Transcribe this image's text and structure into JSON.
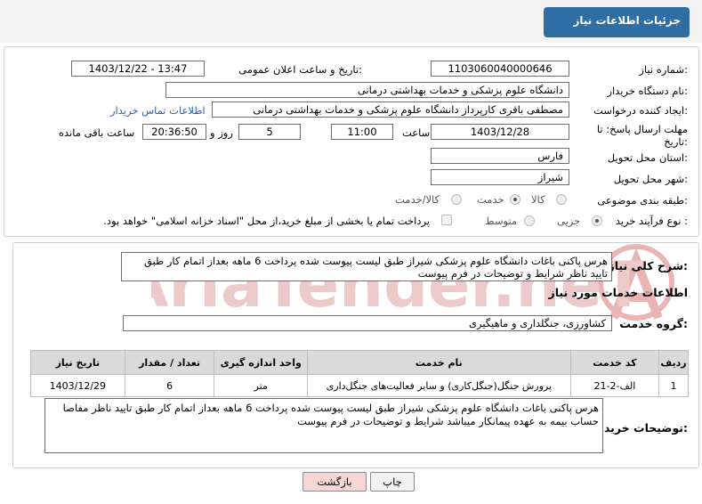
{
  "page_title": "جزئیات اطلاعات نیاز",
  "fields": {
    "need_number_label": "شماره نیاز:",
    "need_number": "1103060040000646",
    "announce_label": "تاریخ و ساعت اعلان عمومی:",
    "announce_value": "1403/12/22 - 13:47",
    "buyer_org_label": "نام دستگاه خریدار:",
    "buyer_org": "دانشگاه علوم پزشکی و خدمات بهداشتی درمانی",
    "creator_label": "ایجاد کننده درخواست:",
    "creator": "مصطفی باقری کارپرداز دانشگاه علوم پزشکی و خدمات بهداشتی درمانی",
    "contact_link": "اطلاعات تماس خریدار",
    "deadline_label": "مهلت ارسال پاسخ: تا تاریخ:",
    "deadline_date": "1403/12/28",
    "time_label": "ساعت",
    "deadline_time": "11:00",
    "days": "5",
    "days_label": "روز و",
    "remaining": "20:36:50",
    "remaining_label": "ساعت باقی مانده",
    "province_label": "استان محل تحویل:",
    "province": "فارس",
    "city_label": "شهر محل تحویل:",
    "city": "شیراز",
    "category_label": "طبقه بندی موضوعی:",
    "category_options": [
      "کالا",
      "خدمت",
      "کالا/خدمت"
    ],
    "process_label": "نوع فرآیند خرید :",
    "process_options": [
      "جزیی",
      "متوسط"
    ],
    "payment_note": "پرداخت تمام یا بخشی از مبلغ خرید،از محل \"اسناد خزانه اسلامی\" خواهد بود."
  },
  "summary": {
    "label": "شرح کلی نیاز:",
    "text": "هرس پاکنی باغات دانشگاه علوم پزشکی شیراز طبق لیست پیوست شده پرداخت 6 ماهه بعداز اتمام کار طبق تایید ناظر شرایط و توضیحات در فرم پیوست"
  },
  "services": {
    "section_title": "اطلاعات خدمات مورد نیاز",
    "group_label": "گروه خدمت:",
    "group": "کشاورزی، جنگلداری و ماهیگیری",
    "headers": [
      "ردیف",
      "کد خدمت",
      "نام خدمت",
      "واحد اندازه گیری",
      "تعداد / مقدار",
      "تاریخ نیاز"
    ],
    "rows": [
      [
        "1",
        "الف-2-21",
        "پرورش جنگل(جنگل‌کاری) و سایر فعالیت‌های جنگل‌داری",
        "متر",
        "6",
        "1403/12/29"
      ]
    ]
  },
  "buyer_notes": {
    "label": "توضیحات خریدار:",
    "text": "هرس پاکنی باغات دانشگاه علوم پزشکی شیراز طبق لیست پیوست شده پرداخت 6 ماهه بعداز اتمام کار طبق تایید ناظر مفاصا حساب بیمه به عهده پیمانکار میباشد شرایط و توضیحات در فرم پیوست"
  },
  "buttons": {
    "print": "چاپ",
    "back": "بازگشت"
  },
  "watermark": "AriaTender.neT",
  "colors": {
    "header_tab": "#2f6ea4",
    "link": "#2563b5",
    "back_button": "#f7d6d6",
    "watermark": "#e8b4b4"
  }
}
